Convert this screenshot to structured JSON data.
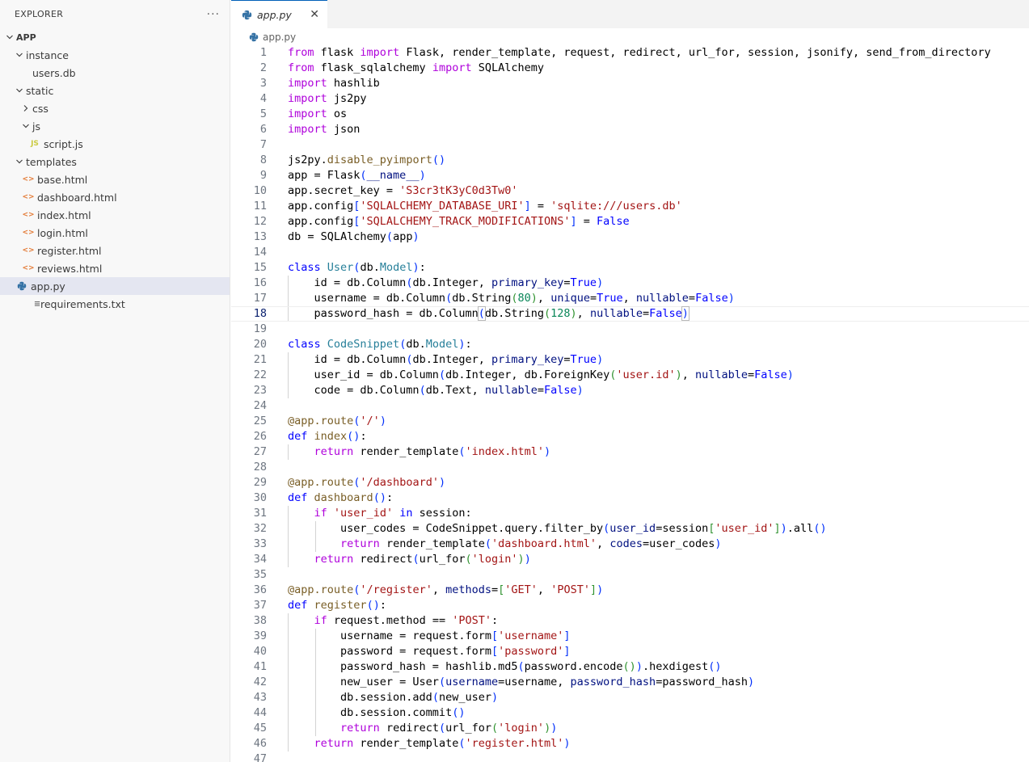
{
  "sidebar": {
    "title": "EXPLORER",
    "more": "···",
    "tree": [
      {
        "label": "APP",
        "depth": 0,
        "kind": "root",
        "open": true
      },
      {
        "label": "instance",
        "depth": 1,
        "kind": "folder",
        "open": true
      },
      {
        "label": "users.db",
        "depth": 2,
        "kind": "db"
      },
      {
        "label": "static",
        "depth": 1,
        "kind": "folder",
        "open": true
      },
      {
        "label": "css",
        "depth": 2,
        "kind": "folder",
        "open": false
      },
      {
        "label": "js",
        "depth": 2,
        "kind": "folder",
        "open": true
      },
      {
        "label": "script.js",
        "depth": 3,
        "kind": "js"
      },
      {
        "label": "templates",
        "depth": 1,
        "kind": "folder",
        "open": true
      },
      {
        "label": "base.html",
        "depth": 2,
        "kind": "html"
      },
      {
        "label": "dashboard.html",
        "depth": 2,
        "kind": "html"
      },
      {
        "label": "index.html",
        "depth": 2,
        "kind": "html"
      },
      {
        "label": "login.html",
        "depth": 2,
        "kind": "html"
      },
      {
        "label": "register.html",
        "depth": 2,
        "kind": "html"
      },
      {
        "label": "reviews.html",
        "depth": 2,
        "kind": "html"
      },
      {
        "label": "app.py",
        "depth": 1,
        "kind": "py",
        "selected": true
      },
      {
        "label": "requirements.txt",
        "depth": 1,
        "kind": "txt"
      }
    ]
  },
  "tab": {
    "label": "app.py",
    "close": "✕"
  },
  "breadcrumb": {
    "file": "app.py"
  },
  "editor": {
    "active_line": 18,
    "lines": [
      "<span class=\"kw2\">from</span> flask <span class=\"kw2\">import</span> Flask, render_template, request, redirect, url_for, session, jsonify, send_from_directory",
      "<span class=\"kw2\">from</span> flask_sqlalchemy <span class=\"kw2\">import</span> SQLAlchemy",
      "<span class=\"kw2\">import</span> hashlib",
      "<span class=\"kw2\">import</span> js2py",
      "<span class=\"kw2\">import</span> os",
      "<span class=\"kw2\">import</span> json",
      "",
      "js2py.<span class=\"fn\">disable_pyimport</span><span class=\"br1\">()</span>",
      "app = Flask<span class=\"br1\">(</span><span class=\"prm\">__name__</span><span class=\"br1\">)</span>",
      "app.secret_key = <span class=\"str\">'S3cr3tK3yC0d3Tw0'</span>",
      "app.config<span class=\"br1\">[</span><span class=\"str\">'SQLALCHEMY_DATABASE_URI'</span><span class=\"br1\">]</span> = <span class=\"str\">'sqlite:///users.db'</span>",
      "app.config<span class=\"br1\">[</span><span class=\"str\">'SQLALCHEMY_TRACK_MODIFICATIONS'</span><span class=\"br1\">]</span> = <span class=\"kw\">False</span>",
      "db = SQLAlchemy<span class=\"br1\">(</span>app<span class=\"br1\">)</span>",
      "",
      "<span class=\"kw\">class</span> <span class=\"cls\">User</span><span class=\"br1\">(</span>db.<span class=\"cls\">Model</span><span class=\"br1\">)</span>:",
      "    id = db.Column<span class=\"br1\">(</span>db.Integer, <span class=\"prm\">primary_key</span>=<span class=\"kw\">True</span><span class=\"br1\">)</span>",
      "    username = db.Column<span class=\"br1\">(</span>db.String<span class=\"br2\">(</span><span class=\"num\">80</span><span class=\"br2\">)</span>, <span class=\"prm\">unique</span>=<span class=\"kw\">True</span>, <span class=\"prm\">nullable</span>=<span class=\"kw\">False</span><span class=\"br1\">)</span>",
      "    password_hash = db.Column<span class=\"br1\" style=\"outline:1px solid #b9b9b9\">(</span>db.String<span class=\"br2\">(</span><span class=\"num\">128</span><span class=\"br2\">)</span>, <span class=\"prm\">nullable</span>=<span class=\"kw\">False</span><span class=\"br1\" style=\"outline:1px solid #b9b9b9\">)</span><span class=\"cursor\"></span>",
      "",
      "<span class=\"kw\">class</span> <span class=\"cls\">CodeSnippet</span><span class=\"br1\">(</span>db.<span class=\"cls\">Model</span><span class=\"br1\">)</span>:",
      "    id = db.Column<span class=\"br1\">(</span>db.Integer, <span class=\"prm\">primary_key</span>=<span class=\"kw\">True</span><span class=\"br1\">)</span>",
      "    user_id = db.Column<span class=\"br1\">(</span>db.Integer, db.ForeignKey<span class=\"br2\">(</span><span class=\"str\">'user.id'</span><span class=\"br2\">)</span>, <span class=\"prm\">nullable</span>=<span class=\"kw\">False</span><span class=\"br1\">)</span>",
      "    code = db.Column<span class=\"br1\">(</span>db.Text, <span class=\"prm\">nullable</span>=<span class=\"kw\">False</span><span class=\"br1\">)</span>",
      "",
      "<span class=\"dec\">@app.route</span><span class=\"br1\">(</span><span class=\"str\">'/'</span><span class=\"br1\">)</span>",
      "<span class=\"kw\">def</span> <span class=\"fn\">index</span><span class=\"br1\">()</span>:",
      "    <span class=\"kw2\">return</span> render_template<span class=\"br1\">(</span><span class=\"str\">'index.html'</span><span class=\"br1\">)</span>",
      "",
      "<span class=\"dec\">@app.route</span><span class=\"br1\">(</span><span class=\"str\">'/dashboard'</span><span class=\"br1\">)</span>",
      "<span class=\"kw\">def</span> <span class=\"fn\">dashboard</span><span class=\"br1\">()</span>:",
      "    <span class=\"kw2\">if</span> <span class=\"str\">'user_id'</span> <span class=\"kw\">in</span> session:",
      "        user_codes = CodeSnippet.query.filter_by<span class=\"br1\">(</span><span class=\"prm\">user_id</span>=session<span class=\"br2\">[</span><span class=\"str\">'user_id'</span><span class=\"br2\">]</span><span class=\"br1\">)</span>.all<span class=\"br1\">()</span>",
      "        <span class=\"kw2\">return</span> render_template<span class=\"br1\">(</span><span class=\"str\">'dashboard.html'</span>, <span class=\"prm\">codes</span>=user_codes<span class=\"br1\">)</span>",
      "    <span class=\"kw2\">return</span> redirect<span class=\"br1\">(</span>url_for<span class=\"br2\">(</span><span class=\"str\">'login'</span><span class=\"br2\">)</span><span class=\"br1\">)</span>",
      "",
      "<span class=\"dec\">@app.route</span><span class=\"br1\">(</span><span class=\"str\">'/register'</span>, <span class=\"prm\">methods</span>=<span class=\"br2\">[</span><span class=\"str\">'GET'</span>, <span class=\"str\">'POST'</span><span class=\"br2\">]</span><span class=\"br1\">)</span>",
      "<span class=\"kw\">def</span> <span class=\"fn\">register</span><span class=\"br1\">()</span>:",
      "    <span class=\"kw2\">if</span> request.method == <span class=\"str\">'POST'</span>:",
      "        username = request.form<span class=\"br1\">[</span><span class=\"str\">'username'</span><span class=\"br1\">]</span>",
      "        password = request.form<span class=\"br1\">[</span><span class=\"str\">'password'</span><span class=\"br1\">]</span>",
      "        password_hash = hashlib.md5<span class=\"br1\">(</span>password.encode<span class=\"br2\">()</span><span class=\"br1\">)</span>.hexdigest<span class=\"br1\">()</span>",
      "        new_user = User<span class=\"br1\">(</span><span class=\"prm\">username</span>=username, <span class=\"prm\">password_hash</span>=password_hash<span class=\"br1\">)</span>",
      "        db.session.add<span class=\"br1\">(</span>new_user<span class=\"br1\">)</span>",
      "        db.session.commit<span class=\"br1\">()</span>",
      "        <span class=\"kw2\">return</span> redirect<span class=\"br1\">(</span>url_for<span class=\"br2\">(</span><span class=\"str\">'login'</span><span class=\"br2\">)</span><span class=\"br1\">)</span>",
      "    <span class=\"kw2\">return</span> render_template<span class=\"br1\">(</span><span class=\"str\">'register.html'</span><span class=\"br1\">)</span>",
      ""
    ]
  }
}
